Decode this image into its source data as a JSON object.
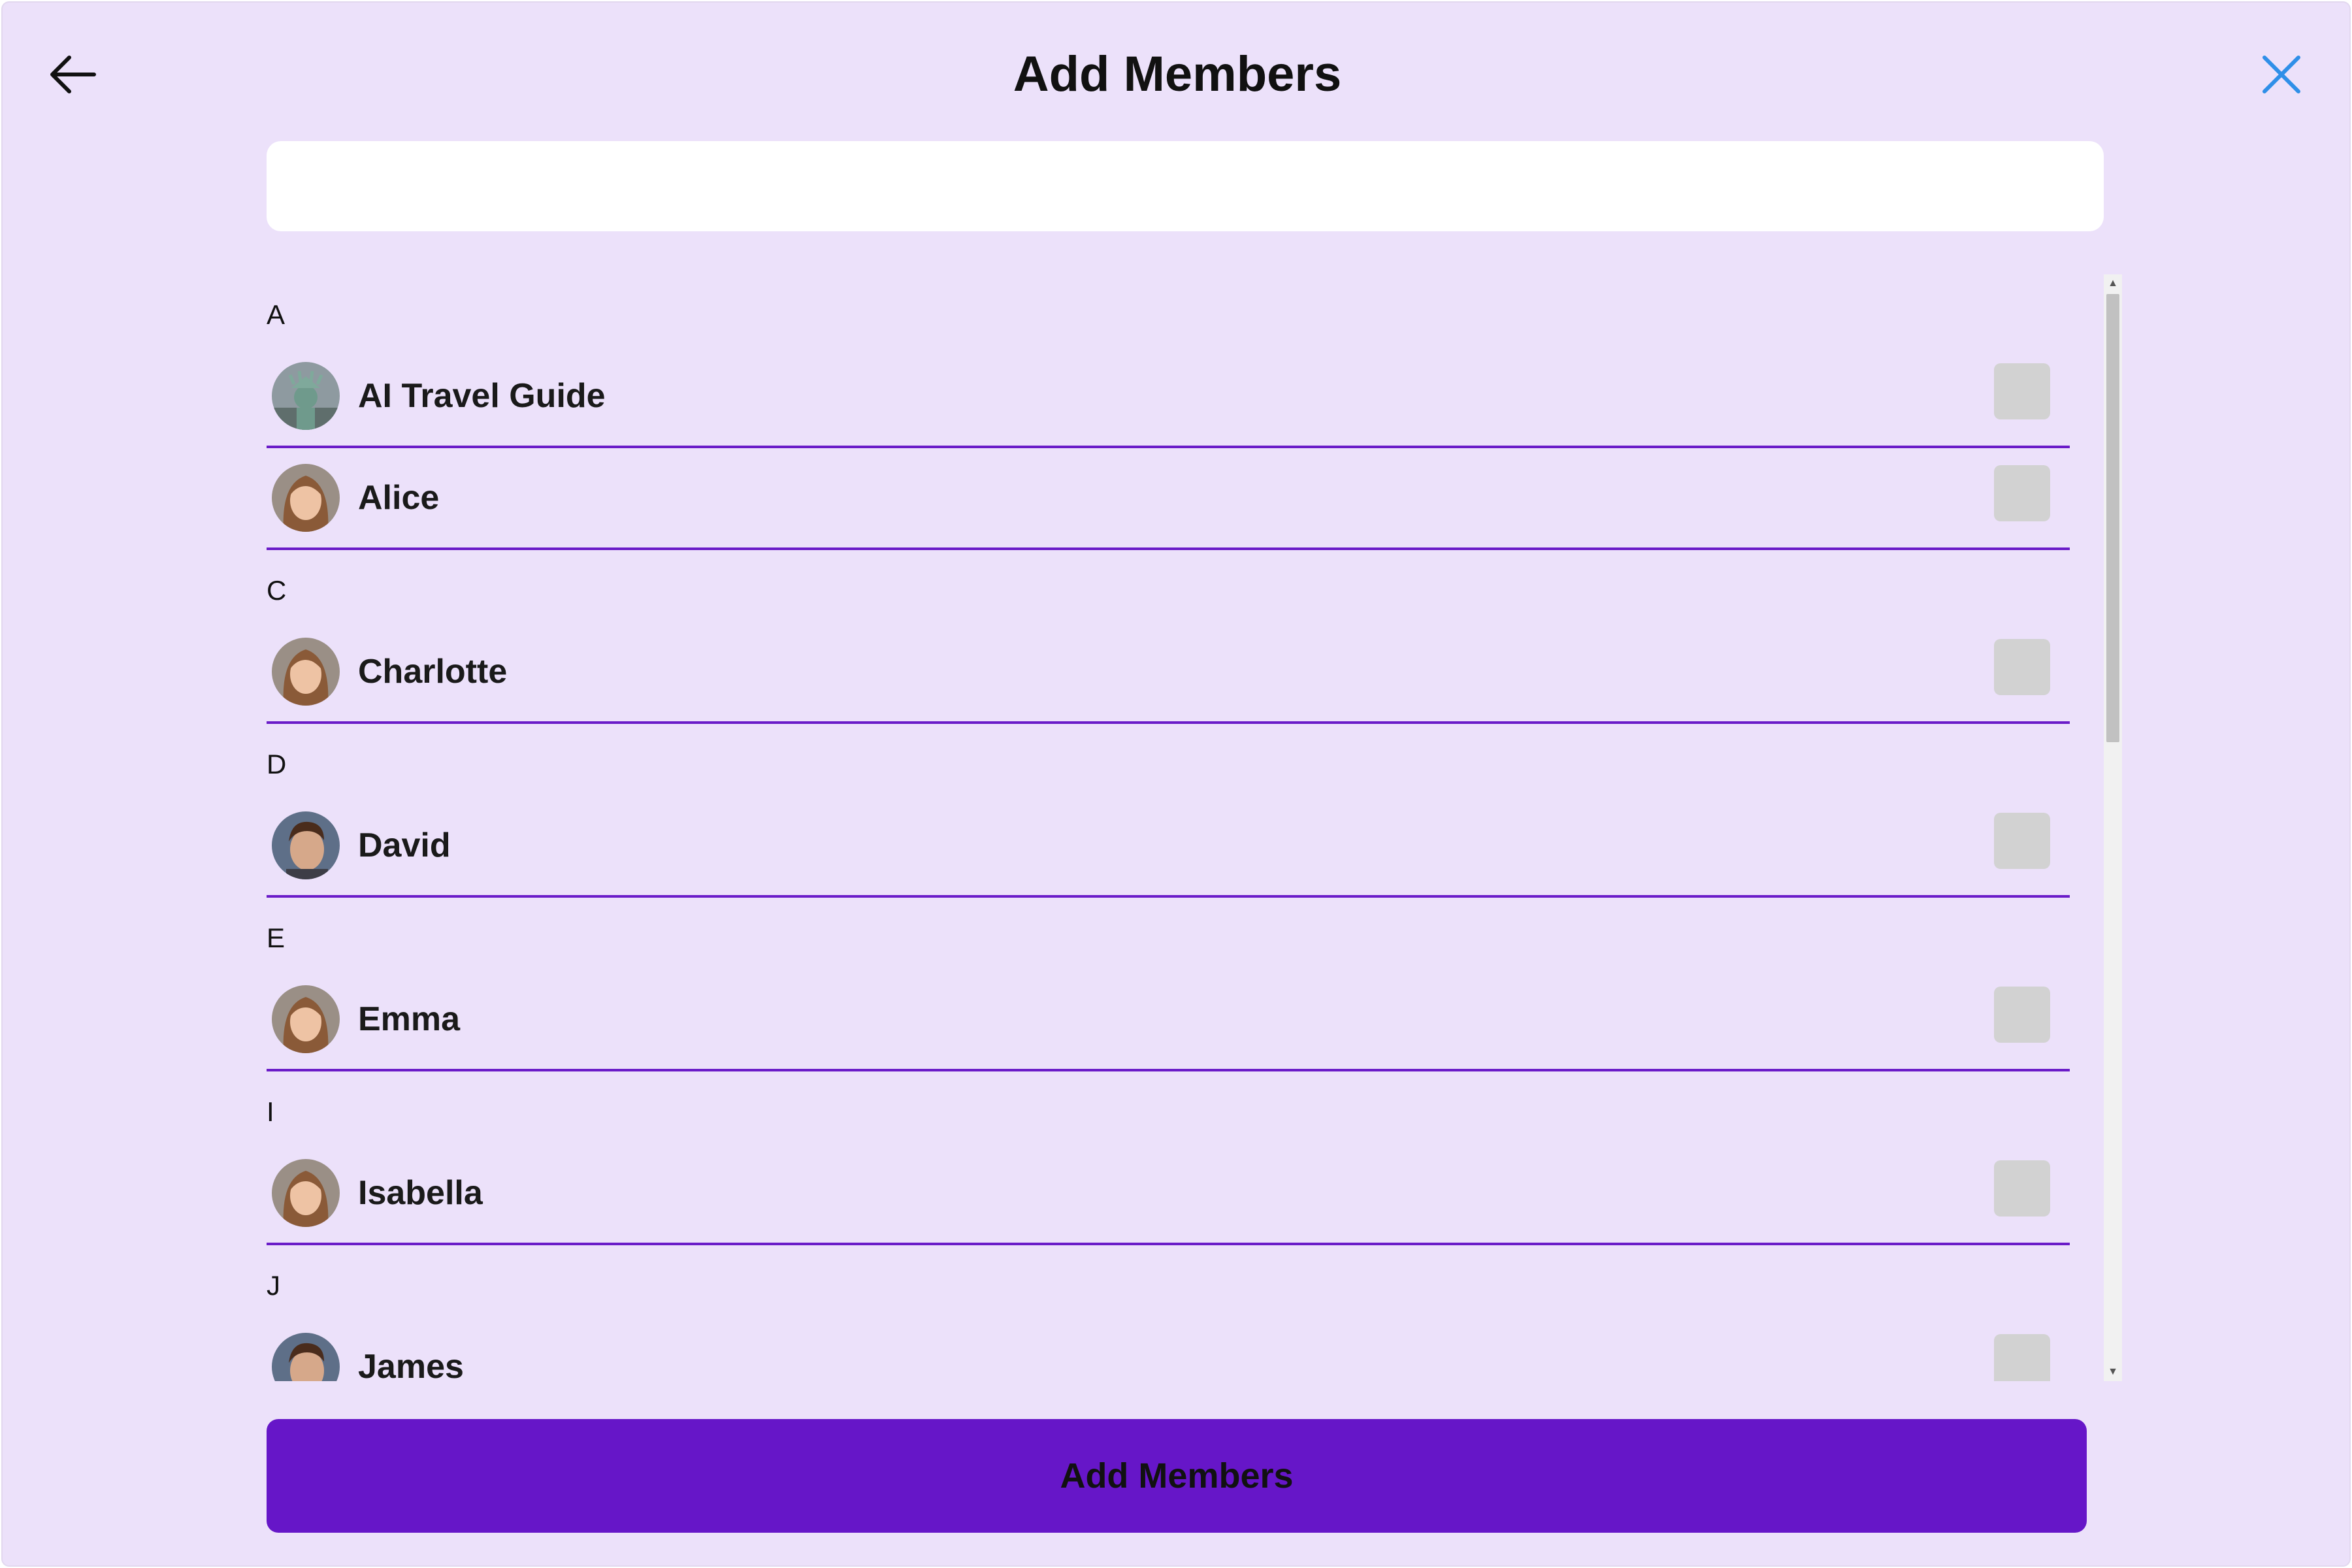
{
  "header": {
    "title": "Add Members",
    "back_icon": "arrow-left-icon",
    "close_icon": "close-icon",
    "close_color": "#2f8fe8"
  },
  "search": {
    "value": "",
    "placeholder": ""
  },
  "contacts": {
    "sections": [
      {
        "letter": "A",
        "items": [
          {
            "name": "AI Travel Guide",
            "avatar": "statue-of-liberty",
            "checked": false
          },
          {
            "name": "Alice",
            "avatar": "female-portrait",
            "checked": false
          }
        ]
      },
      {
        "letter": "C",
        "items": [
          {
            "name": "Charlotte",
            "avatar": "female-portrait",
            "checked": false
          }
        ]
      },
      {
        "letter": "D",
        "items": [
          {
            "name": "David",
            "avatar": "male-portrait",
            "checked": false
          }
        ]
      },
      {
        "letter": "E",
        "items": [
          {
            "name": "Emma",
            "avatar": "female-portrait",
            "checked": false
          }
        ]
      },
      {
        "letter": "I",
        "items": [
          {
            "name": "Isabella",
            "avatar": "female-portrait",
            "checked": false
          }
        ]
      },
      {
        "letter": "J",
        "items": [
          {
            "name": "James",
            "avatar": "male-portrait",
            "checked": false
          }
        ]
      }
    ]
  },
  "scrollbar": {
    "thumb_fraction": 0.42,
    "scroll_position": 0
  },
  "footer": {
    "add_button_label": "Add Members"
  },
  "colors": {
    "background": "#ece1fa",
    "accent": "#6616c8",
    "divider": "#6a1bc8",
    "checkbox": "#d2d2d2"
  }
}
